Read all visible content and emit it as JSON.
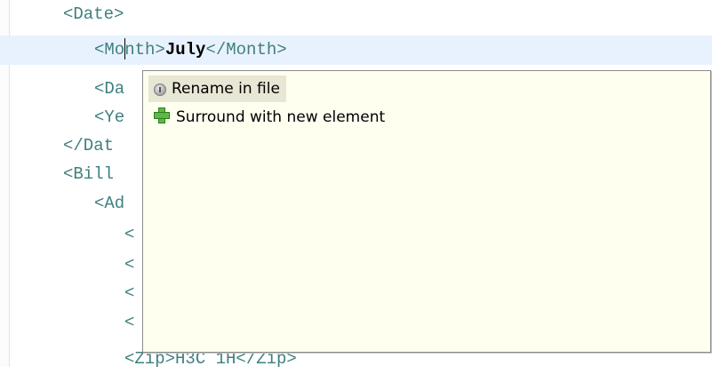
{
  "editor": {
    "lines": {
      "l0": {
        "open": "<Date>"
      },
      "l1": {
        "pre_caret": "<Mo",
        "post_caret": "nth>",
        "value": "July",
        "close": "</Month>"
      },
      "l2": {
        "code": "<Da"
      },
      "l3": {
        "code": "<Ye"
      },
      "l4": {
        "code": "</Dat"
      },
      "l5": {
        "code": "<Bill"
      },
      "l6": {
        "code": "<Ad"
      },
      "l7": {
        "code": "<"
      },
      "l8": {
        "code": "<"
      },
      "l9": {
        "code": "<"
      },
      "l10": {
        "code": "<"
      },
      "l11": {
        "code": "<Zip>H3C 1H</Zip>"
      }
    }
  },
  "quick_assist": {
    "proposals": [
      {
        "label": "Rename in file",
        "icon": "rename-icon"
      },
      {
        "label": "Surround with new element",
        "icon": "add-element-icon"
      }
    ]
  }
}
